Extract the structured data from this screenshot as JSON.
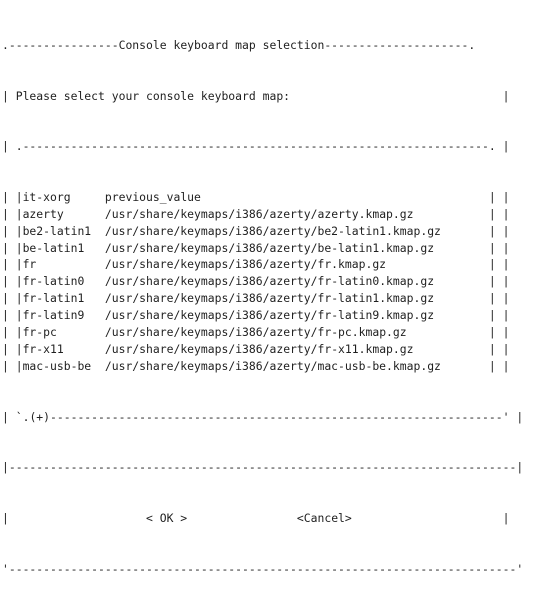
{
  "dialog": {
    "title": "Console keyboard map selection",
    "prompt": "Please select your console keyboard map:",
    "scroll_indicator": "(+)"
  },
  "list": {
    "items": [
      {
        "name": "it-xorg",
        "path": "previous_value"
      },
      {
        "name": "azerty",
        "path": "/usr/share/keymaps/i386/azerty/azerty.kmap.gz"
      },
      {
        "name": "be2-latin1",
        "path": "/usr/share/keymaps/i386/azerty/be2-latin1.kmap.gz"
      },
      {
        "name": "be-latin1",
        "path": "/usr/share/keymaps/i386/azerty/be-latin1.kmap.gz"
      },
      {
        "name": "fr",
        "path": "/usr/share/keymaps/i386/azerty/fr.kmap.gz"
      },
      {
        "name": "fr-latin0",
        "path": "/usr/share/keymaps/i386/azerty/fr-latin0.kmap.gz"
      },
      {
        "name": "fr-latin1",
        "path": "/usr/share/keymaps/i386/azerty/fr-latin1.kmap.gz"
      },
      {
        "name": "fr-latin9",
        "path": "/usr/share/keymaps/i386/azerty/fr-latin9.kmap.gz"
      },
      {
        "name": "fr-pc",
        "path": "/usr/share/keymaps/i386/azerty/fr-pc.kmap.gz"
      },
      {
        "name": "fr-x11",
        "path": "/usr/share/keymaps/i386/azerty/fr-x11.kmap.gz"
      },
      {
        "name": "mac-usb-be",
        "path": "/usr/share/keymaps/i386/azerty/mac-usb-be.kmap.gz"
      }
    ]
  },
  "buttons": {
    "ok": "< OK >",
    "cancel": "<Cancel>"
  }
}
